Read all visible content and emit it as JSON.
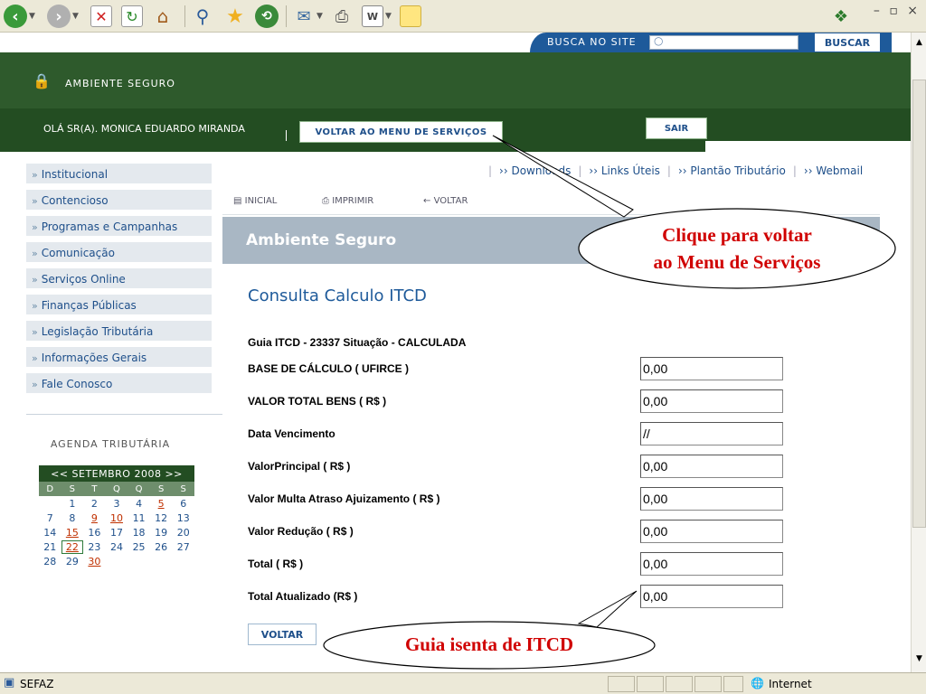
{
  "browser": {
    "status_text": "SEFAZ",
    "zone": "Internet"
  },
  "search": {
    "label": "BUSCA NO SITE",
    "button": "BUSCAR"
  },
  "header": {
    "secure_title": "AMBIENTE SEGURO",
    "greeting": "OLÁ SR(A). MONICA EDUARDO MIRANDA",
    "menu_button": "VOLTAR AO MENU DE SERVIÇOS",
    "logout_button": "SAIR"
  },
  "sidebar": {
    "items": [
      {
        "label": "Institucional"
      },
      {
        "label": "Contencioso"
      },
      {
        "label": "Programas e Campanhas"
      },
      {
        "label": "Comunicação"
      },
      {
        "label": "Serviços Online"
      },
      {
        "label": "Finanças Públicas"
      },
      {
        "label": "Legislação Tributária"
      },
      {
        "label": "Informações Gerais"
      },
      {
        "label": "Fale Conosco"
      }
    ],
    "arrow": "»"
  },
  "agenda": {
    "title": "AGENDA TRIBUTÁRIA",
    "month": "<< SETEMBRO  2008 >>",
    "weekdays": [
      "D",
      "S",
      "T",
      "Q",
      "Q",
      "S",
      "S"
    ],
    "weeks": [
      [
        "",
        "1",
        "2",
        "3",
        "4",
        "5",
        "6"
      ],
      [
        "7",
        "8",
        "9",
        "10",
        "11",
        "12",
        "13"
      ],
      [
        "14",
        "15",
        "16",
        "17",
        "18",
        "19",
        "20"
      ],
      [
        "21",
        "22",
        "23",
        "24",
        "25",
        "26",
        "27"
      ],
      [
        "28",
        "29",
        "30",
        "",
        "",
        "",
        ""
      ]
    ],
    "linked_days": [
      "5",
      "9",
      "10",
      "15",
      "22",
      "30"
    ],
    "today": "22"
  },
  "top_links": [
    {
      "label": "›› Downloads"
    },
    {
      "label": "›› Links Úteis"
    },
    {
      "label": "›› Plantão Tributário"
    },
    {
      "label": "›› Webmail"
    }
  ],
  "actions": {
    "inicial": "INICIAL",
    "imprimir": "IMPRIMIR",
    "voltar": "VOLTAR"
  },
  "page": {
    "band_title": "Ambiente Seguro",
    "heading": "Consulta Calculo ITCD",
    "guia_line": "Guia ITCD - 23337 Situação - CALCULADA",
    "fields": [
      {
        "label": "BASE DE CÁLCULO ( UFIRCE )",
        "value": "0,00"
      },
      {
        "label": "VALOR TOTAL BENS ( R$ )",
        "value": "0,00"
      },
      {
        "label": "Data Vencimento",
        "value": "//"
      },
      {
        "label": "ValorPrincipal ( R$ )",
        "value": "0,00"
      },
      {
        "label": "Valor Multa Atraso Ajuizamento ( R$ )",
        "value": "0,00"
      },
      {
        "label": "Valor Redução ( R$ )",
        "value": "0,00"
      },
      {
        "label": "Total ( R$ )",
        "value": "0,00"
      },
      {
        "label": "Total Atualizado (R$ )",
        "value": "0,00"
      }
    ],
    "back_button": "VOLTAR"
  },
  "callouts": {
    "top_line1": "Clique para voltar",
    "top_line2": "ao Menu de Serviços",
    "bottom": "Guia isenta de ITCD"
  },
  "colors": {
    "header_green": "#234d22",
    "link_blue": "#1e4f8a",
    "callout_red": "#d00000"
  }
}
